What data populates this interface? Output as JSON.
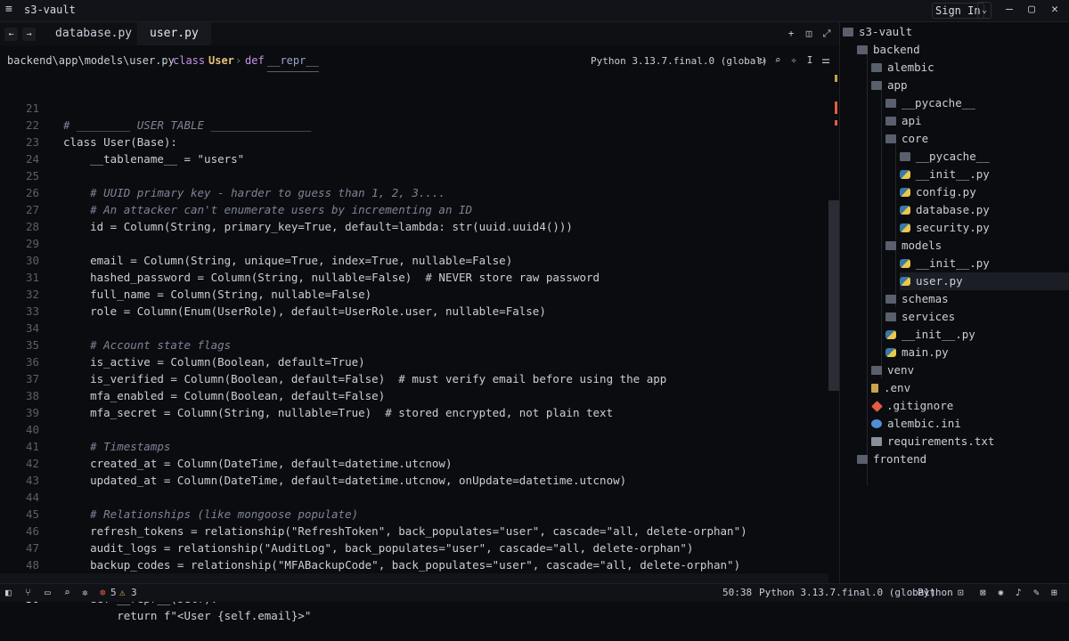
{
  "window": {
    "title": "s3-vault",
    "sign_in": "Sign In"
  },
  "tabs": [
    {
      "label": "database.py",
      "active": false
    },
    {
      "label": "user.py",
      "active": true
    }
  ],
  "breadcrumb": {
    "path": "backend\\app\\models\\user.py",
    "class_kw": "class",
    "class_name": "User",
    "def_kw": "def",
    "fn_name": "__repr__"
  },
  "interpreter": "Python 3.13.7.final.0 (global)",
  "editor": {
    "current_line": 50,
    "lines": [
      {
        "n": "21",
        "t": "# ________ USER TABLE _______________"
      },
      {
        "n": "22",
        "t": "class User(Base):"
      },
      {
        "n": "23",
        "t": "    __tablename__ = \"users\""
      },
      {
        "n": "24",
        "t": ""
      },
      {
        "n": "25",
        "t": "    # UUID primary key - harder to guess than 1, 2, 3...."
      },
      {
        "n": "26",
        "t": "    # An attacker can't enumerate users by incrementing an ID"
      },
      {
        "n": "27",
        "t": "    id = Column(String, primary_key=True, default=lambda: str(uuid.uuid4()))"
      },
      {
        "n": "28",
        "t": ""
      },
      {
        "n": "29",
        "t": "    email = Column(String, unique=True, index=True, nullable=False)"
      },
      {
        "n": "30",
        "t": "    hashed_password = Column(String, nullable=False)  # NEVER store raw password"
      },
      {
        "n": "31",
        "t": "    full_name = Column(String, nullable=False)"
      },
      {
        "n": "32",
        "t": "    role = Column(Enum(UserRole), default=UserRole.user, nullable=False)"
      },
      {
        "n": "33",
        "t": ""
      },
      {
        "n": "34",
        "t": "    # Account state flags"
      },
      {
        "n": "35",
        "t": "    is_active = Column(Boolean, default=True)"
      },
      {
        "n": "36",
        "t": "    is_verified = Column(Boolean, default=False)  # must verify email before using the app"
      },
      {
        "n": "37",
        "t": "    mfa_enabled = Column(Boolean, default=False)"
      },
      {
        "n": "38",
        "t": "    mfa_secret = Column(String, nullable=True)  # stored encrypted, not plain text"
      },
      {
        "n": "39",
        "t": ""
      },
      {
        "n": "40",
        "t": "    # Timestamps"
      },
      {
        "n": "41",
        "t": "    created_at = Column(DateTime, default=datetime.utcnow)"
      },
      {
        "n": "42",
        "t": "    updated_at = Column(DateTime, default=datetime.utcnow, onUpdate=datetime.utcnow)"
      },
      {
        "n": "43",
        "t": ""
      },
      {
        "n": "44",
        "t": "    # Relationships (like mongoose populate)"
      },
      {
        "n": "45",
        "t": "    refresh_tokens = relationship(\"RefreshToken\", back_populates=\"user\", cascade=\"all, delete-orphan\")"
      },
      {
        "n": "46",
        "t": "    audit_logs = relationship(\"AuditLog\", back_populates=\"user\", cascade=\"all, delete-orphan\")"
      },
      {
        "n": "47",
        "t": "    backup_codes = relationship(\"MFABackupCode\", back_populates=\"user\", cascade=\"all, delete-orphan\")"
      },
      {
        "n": "48",
        "t": ""
      },
      {
        "n": "49",
        "t": "    def __repr__(self):"
      },
      {
        "n": "50",
        "t": "        return f\"<User {self.email}>\""
      }
    ]
  },
  "explorer": {
    "items": [
      {
        "label": "s3-vault",
        "depth": 0,
        "icon": "folder"
      },
      {
        "label": "backend",
        "depth": 1,
        "icon": "folder"
      },
      {
        "label": "alembic",
        "depth": 2,
        "icon": "folder"
      },
      {
        "label": "app",
        "depth": 2,
        "icon": "folder"
      },
      {
        "label": "__pycache__",
        "depth": 3,
        "icon": "folder"
      },
      {
        "label": "api",
        "depth": 3,
        "icon": "folder"
      },
      {
        "label": "core",
        "depth": 3,
        "icon": "folder"
      },
      {
        "label": "__pycache__",
        "depth": 4,
        "icon": "folder"
      },
      {
        "label": "__init__.py",
        "depth": 4,
        "icon": "python"
      },
      {
        "label": "config.py",
        "depth": 4,
        "icon": "python"
      },
      {
        "label": "database.py",
        "depth": 4,
        "icon": "python"
      },
      {
        "label": "security.py",
        "depth": 4,
        "icon": "python"
      },
      {
        "label": "models",
        "depth": 3,
        "icon": "folder"
      },
      {
        "label": "__init__.py",
        "depth": 4,
        "icon": "python"
      },
      {
        "label": "user.py",
        "depth": 4,
        "icon": "python",
        "selected": true
      },
      {
        "label": "schemas",
        "depth": 3,
        "icon": "folder"
      },
      {
        "label": "services",
        "depth": 3,
        "icon": "folder"
      },
      {
        "label": "__init__.py",
        "depth": 3,
        "icon": "python"
      },
      {
        "label": "main.py",
        "depth": 3,
        "icon": "python"
      },
      {
        "label": "venv",
        "depth": 2,
        "icon": "folder"
      },
      {
        "label": ".env",
        "depth": 2,
        "icon": "env"
      },
      {
        "label": ".gitignore",
        "depth": 2,
        "icon": "git"
      },
      {
        "label": "alembic.ini",
        "depth": 2,
        "icon": "gear"
      },
      {
        "label": "requirements.txt",
        "depth": 2,
        "icon": "file"
      },
      {
        "label": "frontend",
        "depth": 1,
        "icon": "folder"
      }
    ]
  },
  "status": {
    "errors": "5",
    "warnings": "3",
    "cursor": "50:38",
    "interpreter": "Python 3.13.7.final.0 (global)",
    "language": "Python"
  }
}
